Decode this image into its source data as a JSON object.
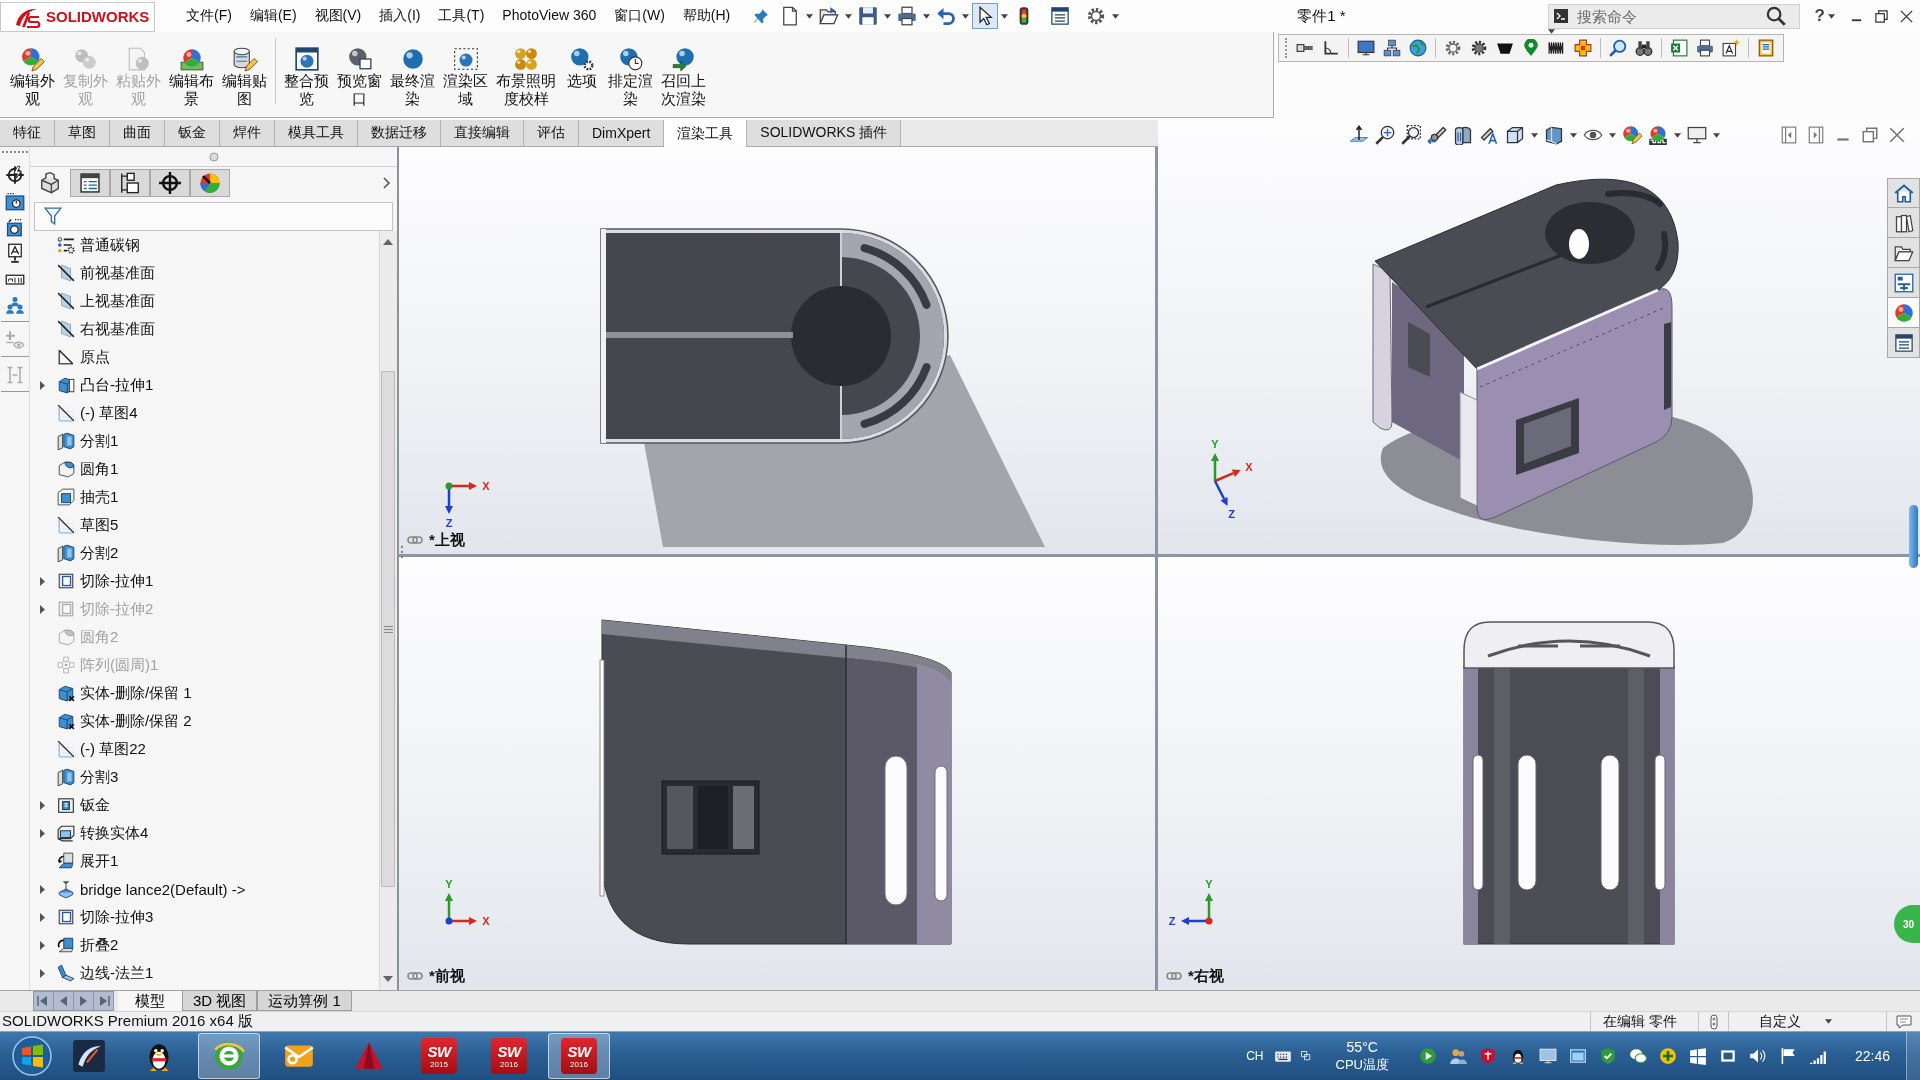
{
  "titlebar": {
    "logo": "SOLIDWORKS",
    "menu": [
      "文件(F)",
      "编辑(E)",
      "视图(V)",
      "插入(I)",
      "工具(T)",
      "PhotoView 360",
      "窗口(W)",
      "帮助(H)"
    ],
    "quick_access": [
      {
        "kind": "new",
        "dropdown": true,
        "selected": false
      },
      {
        "kind": "open",
        "dropdown": true,
        "selected": false
      },
      {
        "kind": "save",
        "dropdown": true,
        "selected": false
      },
      {
        "kind": "print",
        "dropdown": true,
        "selected": false
      },
      {
        "kind": "undo",
        "dropdown": true,
        "selected": false
      },
      {
        "kind": "select",
        "dropdown": true,
        "selected": true
      },
      {
        "kind": "rebuild",
        "dropdown": false,
        "selected": false
      },
      {
        "kind": "file-properties",
        "dropdown": false,
        "selected": false
      },
      {
        "kind": "options",
        "dropdown": true,
        "selected": false
      }
    ],
    "document_title": "零件1 *",
    "search": {
      "placeholder": "搜索命令"
    },
    "help": "?"
  },
  "command_groups": [
    [
      {
        "label": "编辑外观",
        "disabled": false
      },
      {
        "label": "复制外观",
        "disabled": true
      },
      {
        "label": "粘贴外观",
        "disabled": true
      },
      {
        "label": "编辑布景",
        "disabled": false
      },
      {
        "label": "编辑贴图",
        "disabled": false
      }
    ],
    [
      {
        "label": "整合预览",
        "disabled": false
      },
      {
        "label": "预览窗口",
        "disabled": false
      },
      {
        "label": "最终渲染",
        "disabled": false
      },
      {
        "label": "渲染区域",
        "disabled": false
      },
      {
        "label": "布景照明度校样",
        "disabled": false
      },
      {
        "label": "选项",
        "disabled": false
      },
      {
        "label": "排定渲染",
        "disabled": false
      },
      {
        "label": "召回上次渲染",
        "disabled": false
      }
    ]
  ],
  "tabs": [
    {
      "label": "特征",
      "selected": false
    },
    {
      "label": "草图",
      "selected": false
    },
    {
      "label": "曲面",
      "selected": false
    },
    {
      "label": "钣金",
      "selected": false
    },
    {
      "label": "焊件",
      "selected": false
    },
    {
      "label": "模具工具",
      "selected": false
    },
    {
      "label": "数据迁移",
      "selected": false
    },
    {
      "label": "直接编辑",
      "selected": false
    },
    {
      "label": "评估",
      "selected": false
    },
    {
      "label": "DimXpert",
      "selected": false
    },
    {
      "label": "渲染工具",
      "selected": true
    },
    {
      "label": "SOLIDWORKS 插件",
      "selected": false
    }
  ],
  "feature_manager": {
    "panel_tabs": [
      {
        "kind": "feature-tree",
        "selected": true
      },
      {
        "kind": "property",
        "selected": false
      },
      {
        "kind": "configuration",
        "selected": false
      },
      {
        "kind": "dimxpert",
        "selected": false
      },
      {
        "kind": "display",
        "selected": false
      }
    ],
    "tree": [
      {
        "label": "普通碳钢",
        "kind": "material",
        "expandable": false,
        "suppressed": false
      },
      {
        "label": "前视基准面",
        "kind": "plane",
        "expandable": false,
        "suppressed": false
      },
      {
        "label": "上视基准面",
        "kind": "plane",
        "expandable": false,
        "suppressed": false
      },
      {
        "label": "右视基准面",
        "kind": "plane",
        "expandable": false,
        "suppressed": false
      },
      {
        "label": "原点",
        "kind": "origin",
        "expandable": false,
        "suppressed": false
      },
      {
        "label": "凸台-拉伸1",
        "kind": "extrude",
        "expandable": true,
        "suppressed": false
      },
      {
        "label": "(-) 草图4",
        "kind": "sketch",
        "expandable": false,
        "suppressed": false
      },
      {
        "label": "分割1",
        "kind": "split",
        "expandable": false,
        "suppressed": false
      },
      {
        "label": "圆角1",
        "kind": "fillet",
        "expandable": false,
        "suppressed": false
      },
      {
        "label": "抽壳1",
        "kind": "shell",
        "expandable": false,
        "suppressed": false
      },
      {
        "label": "草图5",
        "kind": "sketch",
        "expandable": false,
        "suppressed": false
      },
      {
        "label": "分割2",
        "kind": "split",
        "expandable": false,
        "suppressed": false
      },
      {
        "label": "切除-拉伸1",
        "kind": "cut",
        "expandable": true,
        "suppressed": false
      },
      {
        "label": "切除-拉伸2",
        "kind": "cut",
        "expandable": true,
        "suppressed": true
      },
      {
        "label": "圆角2",
        "kind": "fillet",
        "expandable": false,
        "suppressed": true
      },
      {
        "label": "阵列(圆周)1",
        "kind": "pattern",
        "expandable": false,
        "suppressed": true
      },
      {
        "label": "实体-删除/保留 1",
        "kind": "body-delete",
        "expandable": false,
        "suppressed": false
      },
      {
        "label": "实体-删除/保留 2",
        "kind": "body-delete",
        "expandable": false,
        "suppressed": false
      },
      {
        "label": "(-) 草图22",
        "kind": "sketch",
        "expandable": false,
        "suppressed": false
      },
      {
        "label": "分割3",
        "kind": "split",
        "expandable": false,
        "suppressed": false
      },
      {
        "label": "钣金",
        "kind": "sheet-metal",
        "expandable": true,
        "suppressed": false
      },
      {
        "label": "转换实体4",
        "kind": "convert",
        "expandable": true,
        "suppressed": false
      },
      {
        "label": "展开1",
        "kind": "unfold",
        "expandable": false,
        "suppressed": false
      },
      {
        "label": "bridge lance2(Default) ->",
        "kind": "library",
        "expandable": true,
        "suppressed": false
      },
      {
        "label": "切除-拉伸3",
        "kind": "cut",
        "expandable": true,
        "suppressed": false
      },
      {
        "label": "折叠2",
        "kind": "fold",
        "expandable": true,
        "suppressed": false
      },
      {
        "label": "边线-法兰1",
        "kind": "edge-flange",
        "expandable": true,
        "suppressed": false
      }
    ]
  },
  "viewports": [
    {
      "kind": "top",
      "label": "*上视",
      "axes": [
        {
          "label": "X",
          "kind": "right",
          "color": "#d42a1c"
        },
        {
          "label": "Z",
          "kind": "down",
          "color": "#1f3fd0"
        }
      ]
    },
    {
      "kind": "isometric",
      "axes": [
        {
          "label": "Y",
          "kind": "up",
          "color": "#2a9a2a"
        },
        {
          "label": "X",
          "kind": "up-right",
          "color": "#d42a1c"
        },
        {
          "label": "Z",
          "kind": "down-right",
          "color": "#1f3fd0"
        }
      ]
    },
    {
      "kind": "front",
      "label": "*前视",
      "axes": [
        {
          "label": "Y",
          "kind": "up",
          "color": "#2a9a2a"
        },
        {
          "label": "X",
          "kind": "right",
          "color": "#d42a1c"
        }
      ]
    },
    {
      "kind": "right",
      "label": "*右视",
      "axes": [
        {
          "label": "Y",
          "kind": "up",
          "color": "#2a9a2a"
        },
        {
          "label": "Z",
          "kind": "left",
          "color": "#1f3fd0"
        }
      ]
    }
  ],
  "task_pane": [
    {
      "kind": "home",
      "selected": false
    },
    {
      "kind": "library",
      "selected": false
    },
    {
      "kind": "folder",
      "selected": false
    },
    {
      "kind": "palette",
      "selected": false
    },
    {
      "kind": "appearance",
      "selected": true
    },
    {
      "kind": "properties",
      "selected": false
    }
  ],
  "side_widget": "30",
  "bottom_tabs": [
    {
      "label": "模型",
      "selected": true
    },
    {
      "label": "3D 视图",
      "selected": false
    },
    {
      "label": "运动算例 1",
      "selected": false
    }
  ],
  "status_bar": {
    "product": "SOLIDWORKS Premium 2016 x64 版",
    "mode": "在编辑 零件",
    "units": "自定义"
  },
  "taskbar": {
    "apps": [
      {
        "kind": "design-app",
        "active": false
      },
      {
        "kind": "chat",
        "active": false
      },
      {
        "kind": "browser",
        "active": true
      },
      {
        "kind": "mail",
        "active": false
      },
      {
        "kind": "cad",
        "active": false
      },
      {
        "kind": "sw",
        "label": "SW",
        "version": "2015",
        "active": false
      },
      {
        "kind": "sw",
        "label": "SW",
        "version": "2016",
        "active": false
      },
      {
        "kind": "sw",
        "label": "SW",
        "version": "2016",
        "active": true
      }
    ],
    "tray": {
      "language": "CH",
      "temperature": "55°C",
      "temperature_label": "CPU温度",
      "time": "22:46"
    }
  }
}
